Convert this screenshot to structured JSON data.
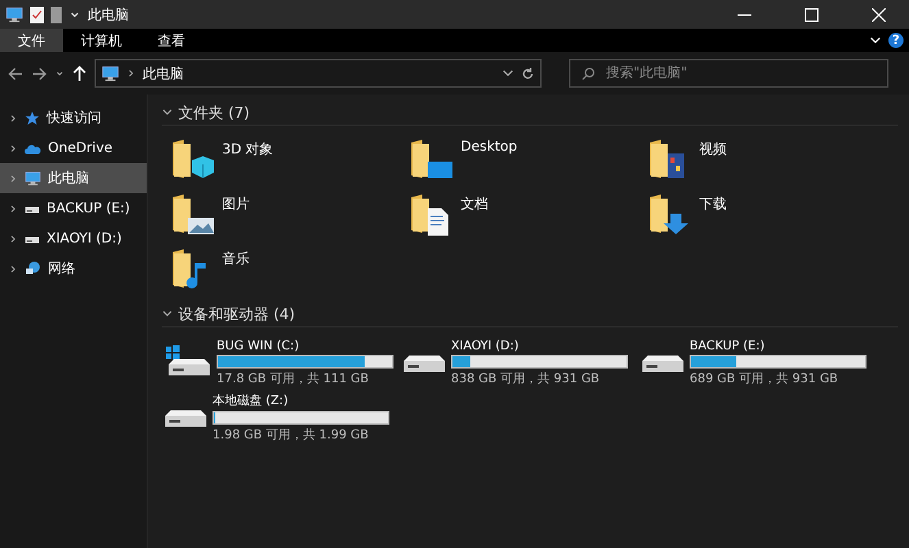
{
  "window": {
    "title": "此电脑"
  },
  "ribbon_tabs": [
    {
      "label": "文件",
      "selected": true
    },
    {
      "label": "计算机",
      "selected": false
    },
    {
      "label": "查看",
      "selected": false
    }
  ],
  "help": "?",
  "address": {
    "path": "此电脑"
  },
  "search": {
    "placeholder": "搜索\"此电脑\""
  },
  "nav": {
    "items": [
      {
        "label": "快速访问",
        "kind": "star",
        "selected": false
      },
      {
        "label": "OneDrive",
        "kind": "cloud",
        "selected": false
      },
      {
        "label": "此电脑",
        "kind": "computer",
        "selected": true
      },
      {
        "label": "BACKUP (E:)",
        "kind": "drive",
        "selected": false
      },
      {
        "label": "XIAOYI (D:)",
        "kind": "drive",
        "selected": false
      },
      {
        "label": "网络",
        "kind": "network",
        "selected": false
      }
    ]
  },
  "folders": {
    "title": "文件夹 (7)",
    "items": [
      {
        "label": "3D 对象",
        "kind": "objects3d"
      },
      {
        "label": "Desktop",
        "kind": "desktop"
      },
      {
        "label": "视频",
        "kind": "video"
      },
      {
        "label": "图片",
        "kind": "pictures"
      },
      {
        "label": "文档",
        "kind": "documents"
      },
      {
        "label": "下载",
        "kind": "downloads"
      },
      {
        "label": "音乐",
        "kind": "music"
      }
    ]
  },
  "drives": {
    "title": "设备和驱动器 (4)",
    "items": [
      {
        "label": "BUG WIN (C:)",
        "kind": "system",
        "level": 0.84,
        "reading": "17.8 GB 可用，共 111 GB"
      },
      {
        "label": "XIAOYI (D:)",
        "kind": "drive",
        "level": 0.1,
        "reading": "838 GB 可用，共 931 GB"
      },
      {
        "label": "BACKUP (E:)",
        "kind": "drive",
        "level": 0.26,
        "reading": "689 GB 可用，共 931 GB"
      },
      {
        "label": "本地磁盘 (Z:)",
        "kind": "drive",
        "level": 0.005,
        "reading": "1.98 GB 可用，共 1.99 GB"
      }
    ]
  }
}
